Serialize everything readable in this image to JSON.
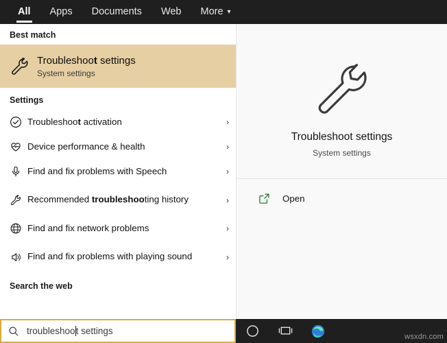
{
  "tabs": [
    {
      "label": "All",
      "active": true,
      "caret": false
    },
    {
      "label": "Apps",
      "active": false,
      "caret": false
    },
    {
      "label": "Documents",
      "active": false,
      "caret": false
    },
    {
      "label": "Web",
      "active": false,
      "caret": false
    },
    {
      "label": "More",
      "active": false,
      "caret": true,
      "caret_glyph": "▾"
    }
  ],
  "left": {
    "best_match_header": "Best match",
    "best_match": {
      "title_prefix": "Troubleshoo",
      "title_bold": "t",
      "title_suffix": " settings",
      "subtitle": "System settings",
      "icon": "wrench-icon"
    },
    "settings_header": "Settings",
    "settings_items": [
      {
        "prefix": "Troubleshoo",
        "bold": "t",
        "suffix": " activation",
        "icon": "check-circle-icon",
        "chevron": "›"
      },
      {
        "prefix": "Device performance & health",
        "bold": "",
        "suffix": "",
        "icon": "heart-monitor-icon",
        "chevron": "›"
      },
      {
        "prefix": "Find and fix problems with Speech",
        "bold": "",
        "suffix": "",
        "icon": "microphone-icon",
        "chevron": "›"
      },
      {
        "prefix": "Recommended ",
        "bold": "troubleshoo",
        "suffix": "ting history",
        "icon": "wrench-small-icon",
        "chevron": "›"
      },
      {
        "prefix": "Find and fix network problems",
        "bold": "",
        "suffix": "",
        "icon": "globe-icon",
        "chevron": "›"
      },
      {
        "prefix": "Find and fix problems with playing sound",
        "bold": "",
        "suffix": "",
        "icon": "speaker-icon",
        "chevron": "›"
      }
    ],
    "web_header": "Search the web"
  },
  "right": {
    "title": "Troubleshoot settings",
    "subtitle": "System settings",
    "icon": "wrench-icon-large",
    "actions": [
      {
        "label": "Open",
        "icon": "open-external-icon"
      }
    ]
  },
  "taskbar": {
    "search_text_before_caret": "troubleshoo",
    "search_text_after_caret": "t settings",
    "search_icon": "search-icon",
    "icons": [
      {
        "name": "cortana-circle-icon"
      },
      {
        "name": "task-view-icon"
      },
      {
        "name": "edge-browser-icon"
      }
    ]
  },
  "watermark": "wsxdn.com",
  "colors": {
    "taskbar_bg": "#1f1f1f",
    "best_match_bg": "#e7cfa4",
    "search_border": "#d9a93c",
    "right_pane_bg": "#f9f9f9"
  }
}
